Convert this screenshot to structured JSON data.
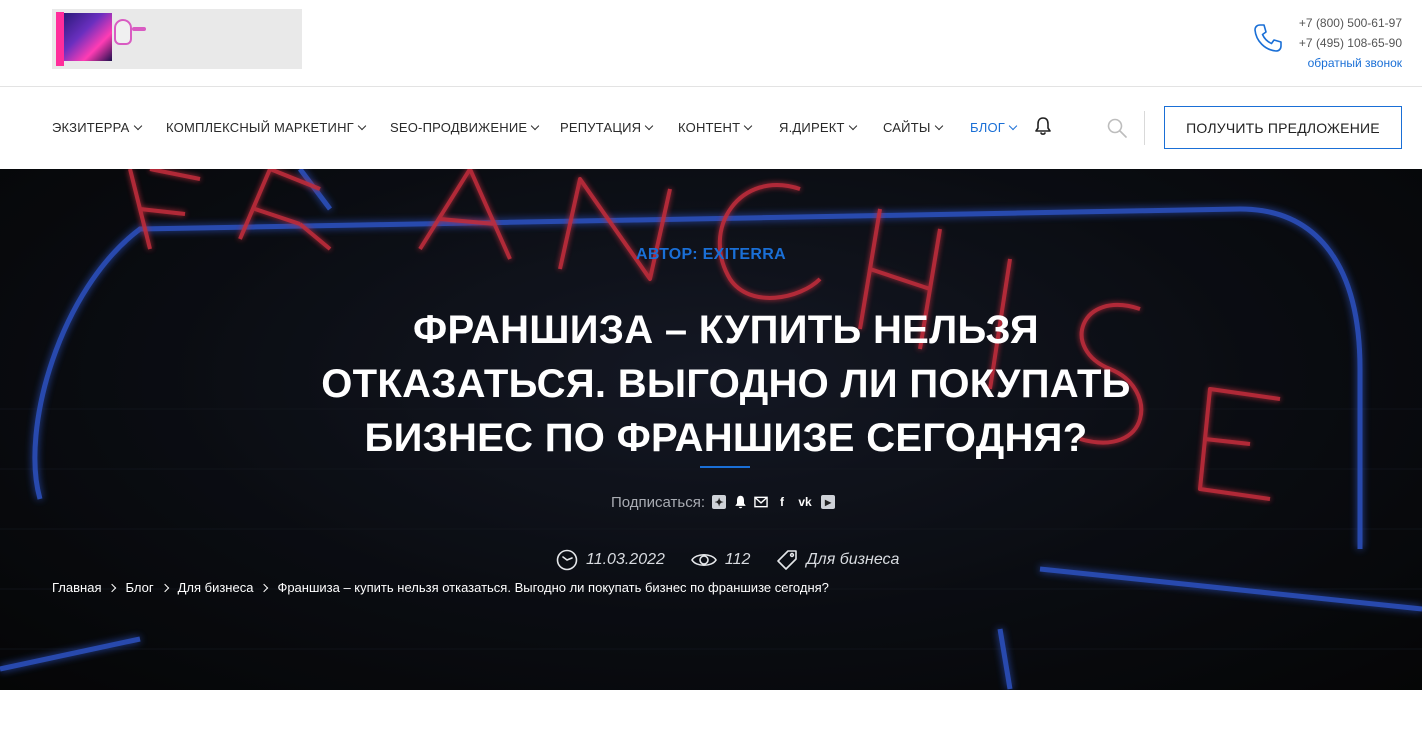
{
  "header": {
    "logo_alt": "Экзитерра",
    "phones": [
      "+7 (800) 500-61-97",
      "+7 (495) 108-65-90"
    ],
    "callback_label": "обратный звонок"
  },
  "nav": {
    "items": [
      {
        "label": "Экзитерра",
        "active": false
      },
      {
        "label": "Комплексный маркетинг",
        "active": false
      },
      {
        "label": "SEO-продвижение",
        "active": false
      },
      {
        "label": "Репутация",
        "active": false
      },
      {
        "label": "Контент",
        "active": false
      },
      {
        "label": "Я.Директ",
        "active": false
      },
      {
        "label": "Сайты",
        "active": false
      },
      {
        "label": "Блог",
        "active": true
      }
    ],
    "offer_button": "Получить предложение"
  },
  "hero": {
    "author": "Автор: EXITERRA",
    "title": "Франшиза – купить нельзя отказаться. Выгодно ли покупать бизнес по франшизе сегодня?",
    "subscribe_label": "Подписаться:",
    "subscribe_icons": [
      "dzen-icon",
      "bell-icon",
      "mail-icon",
      "facebook-icon",
      "vk-icon",
      "youtube-icon"
    ],
    "date": "11.03.2022",
    "views": "112",
    "category": "Для бизнеса"
  },
  "breadcrumb": [
    "Главная",
    "Блог",
    "Для бизнеса",
    "Франшиза – купить нельзя отказаться. Выгодно ли покупать бизнес по франшизе сегодня?"
  ],
  "colors": {
    "accent": "#1a6fd6",
    "hero_bg": "#0e1118",
    "neon_red": "#ff3b4f",
    "neon_blue": "#3a6cff"
  }
}
